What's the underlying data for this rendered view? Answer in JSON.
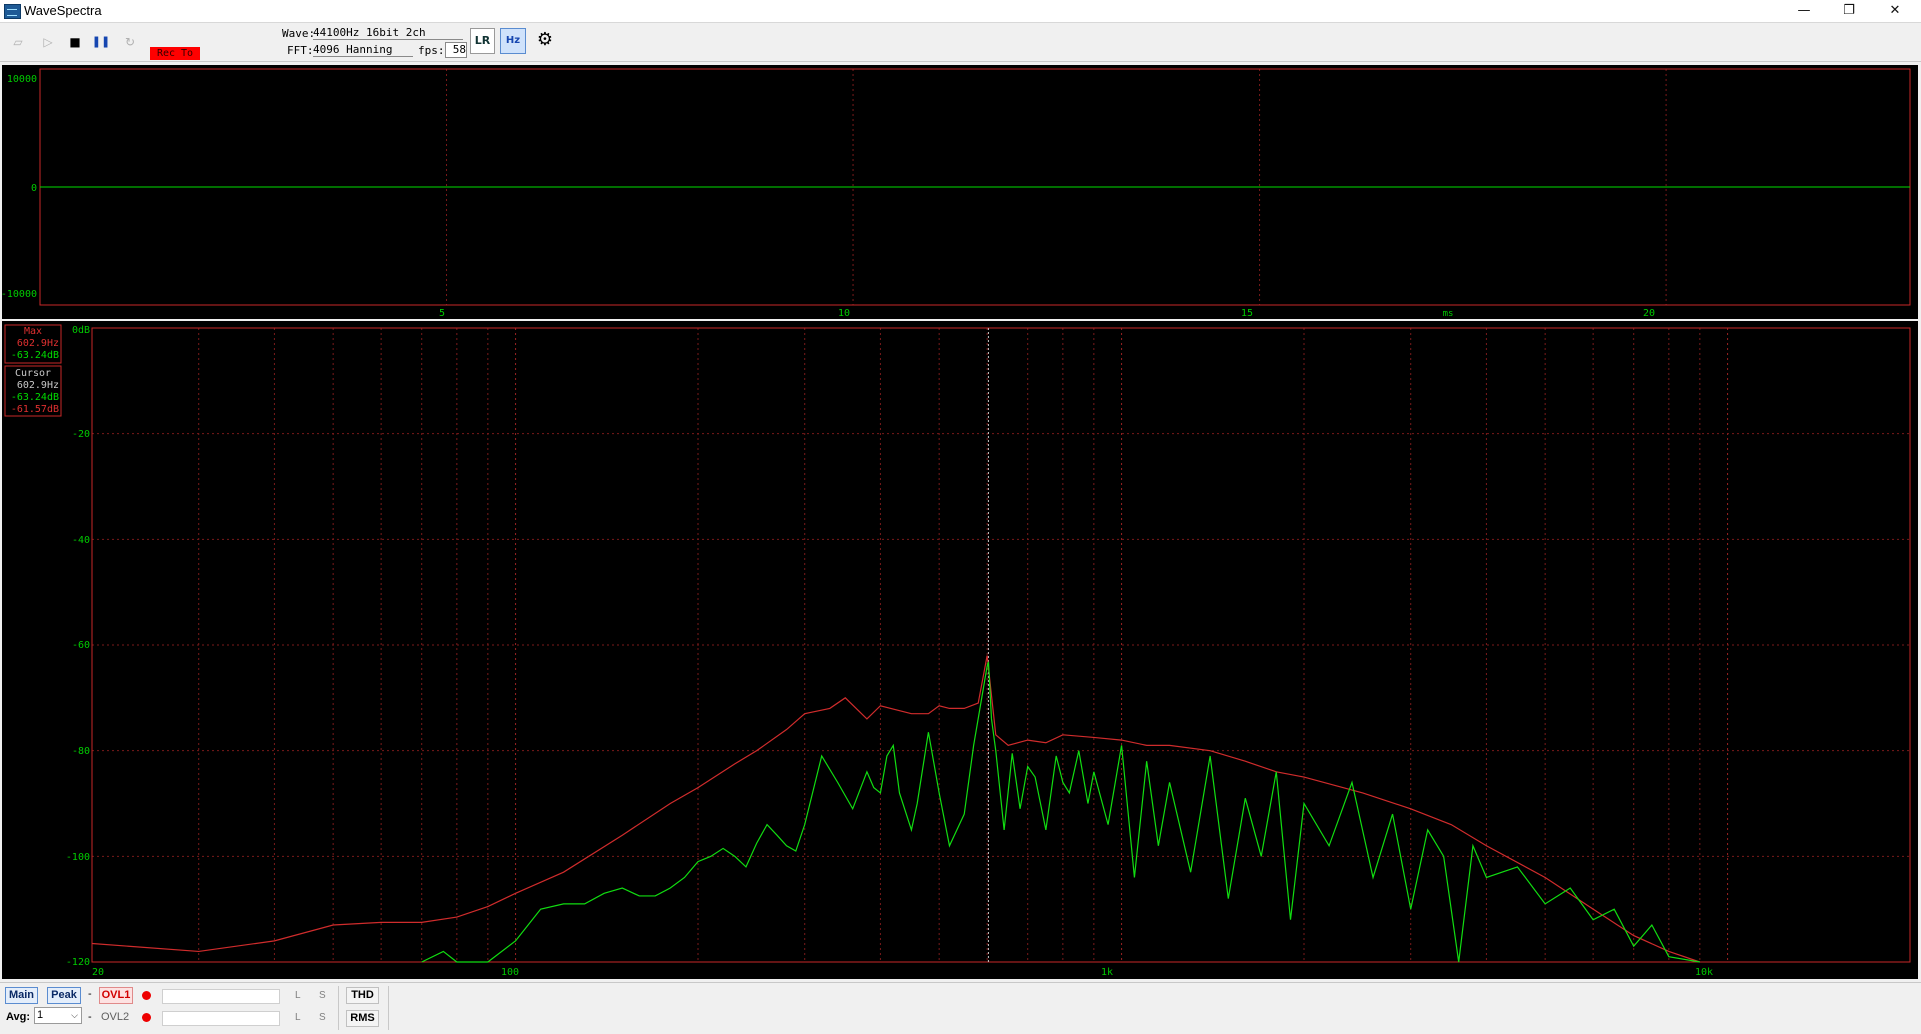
{
  "window": {
    "title": "WaveSpectra",
    "minimize_glyph": "—",
    "restore_glyph": "❐",
    "close_glyph": "✕"
  },
  "toolbar": {
    "rec_label": "Rec To",
    "wave_label": "Wave:",
    "wave_value": "44100Hz 16bit 2ch",
    "fft_label": "FFT:",
    "fft_value": "4096 Hanning",
    "fps_label": "fps:",
    "fps_value": "58",
    "lr_button": "LR",
    "icons": {
      "record_icon": "▱",
      "play_icon": "▷",
      "stop_icon": "■",
      "pause_icon": "❚❚",
      "loop_icon": "↻",
      "hz_icon": "Hz",
      "settings_icon": "⚙"
    }
  },
  "wave_chart": {
    "ytick_labels": [
      "10000",
      "0",
      "-10000"
    ],
    "xtick_labels": [
      "5",
      "10",
      "15",
      "ms",
      "20"
    ]
  },
  "spectrum_chart": {
    "ytick_labels": [
      "0dB",
      "-20",
      "-40",
      "-60",
      "-80",
      "-100",
      "-120"
    ],
    "xtick_labels": [
      "20",
      "100",
      "1k",
      "10k"
    ],
    "max_box": {
      "label": "Max",
      "freq": "602.9Hz",
      "level": "-63.24dB"
    },
    "cursor_box": {
      "label": "Cursor",
      "freq": "602.9Hz",
      "level_green": "-63.24dB",
      "level_red": "-61.57dB"
    }
  },
  "chart_data": [
    {
      "type": "line",
      "x": [
        0,
        23
      ],
      "series": [
        {
          "values": [
            0,
            0
          ]
        }
      ],
      "xlim": [
        0,
        23
      ],
      "ylim": [
        -10000,
        10000
      ],
      "grid": true,
      "colors": {
        "background": "#000000",
        "frame": "#c82828",
        "grid": "#7a1a1a",
        "signal": "#00dd00",
        "label": "#00cc00"
      }
    },
    {
      "type": "line",
      "xscale": "log",
      "xlim": [
        20,
        20000
      ],
      "ylim": [
        -120,
        0
      ],
      "grid": true,
      "cursor_x": 602.9,
      "colors": {
        "background": "#000000",
        "frame": "#c82828",
        "grid": "#7a1a1a",
        "max_line": "#d02c2c",
        "live_line": "#11dd11",
        "label": "#00cc00"
      },
      "series": [
        {
          "x": [
            20,
            30,
            40,
            50,
            60,
            70,
            80,
            90,
            100,
            120,
            150,
            180,
            200,
            230,
            250,
            280,
            300,
            330,
            350,
            380,
            400,
            450,
            480,
            500,
            520,
            550,
            580,
            600,
            620,
            650,
            700,
            750,
            800,
            900,
            1000,
            1100,
            1200,
            1400,
            1600,
            1800,
            2000,
            2500,
            3000,
            3500,
            4000,
            5000,
            6000,
            7000,
            8000,
            9000
          ],
          "values": [
            -116.5,
            -118,
            -116,
            -113,
            -112.5,
            -112.5,
            -111.5,
            -109.5,
            -107,
            -103,
            -96,
            -90,
            -87,
            -82.5,
            -80,
            -76,
            -73,
            -72,
            -70,
            -74,
            -71.5,
            -73,
            -73,
            -71.5,
            -72,
            -72,
            -71,
            -62,
            -77,
            -79,
            -78,
            -78.5,
            -77,
            -77.5,
            -78,
            -79,
            -79,
            -80,
            -82,
            -84,
            -85,
            -88,
            -91,
            -94,
            -98,
            -104,
            -110,
            -115,
            -118,
            -120
          ]
        },
        {
          "x": [
            70,
            76,
            80,
            90,
            100,
            110,
            120,
            130,
            140,
            150,
            160,
            170,
            180,
            190,
            200,
            210,
            220,
            230,
            240,
            250,
            260,
            270,
            280,
            290,
            300,
            320,
            340,
            360,
            380,
            390,
            400,
            410,
            420,
            430,
            450,
            460,
            480,
            500,
            520,
            550,
            570,
            600,
            603,
            610,
            620,
            640,
            660,
            680,
            700,
            720,
            750,
            780,
            800,
            820,
            850,
            880,
            900,
            950,
            1000,
            1050,
            1100,
            1150,
            1200,
            1300,
            1400,
            1500,
            1600,
            1700,
            1800,
            1900,
            2000,
            2200,
            2400,
            2600,
            2800,
            3000,
            3200,
            3400,
            3600,
            3800,
            4000,
            4500,
            5000,
            5500,
            6000,
            6500,
            7000,
            7500,
            8000,
            9000
          ],
          "values": [
            -120,
            -118,
            -120,
            -120,
            -116,
            -110,
            -109,
            -109,
            -107,
            -106,
            -107.5,
            -107.5,
            -106,
            -104,
            -101,
            -100,
            -98.5,
            -100,
            -102,
            -97.5,
            -94,
            -96,
            -98,
            -99,
            -94,
            -81,
            -86,
            -91,
            -84,
            -87,
            -88,
            -81,
            -79,
            -88,
            -95,
            -90,
            -76.5,
            -88,
            -98,
            -92,
            -79,
            -64,
            -63.2,
            -74,
            -80,
            -95,
            -80.5,
            -91,
            -83,
            -85,
            -95,
            -81,
            -86,
            -88,
            -80,
            -90,
            -84,
            -94,
            -79,
            -104,
            -82,
            -98,
            -86,
            -103,
            -81,
            -108,
            -89,
            -100,
            -84,
            -112,
            -90,
            -98,
            -86,
            -104,
            -92,
            -110,
            -95,
            -100,
            -120,
            -98,
            -104,
            -102,
            -109,
            -106,
            -112,
            -110,
            -117,
            -113,
            -119,
            -120
          ]
        }
      ]
    }
  ],
  "bottom": {
    "main_button": "Main",
    "peak_button": "Peak",
    "dash1": "-",
    "ovl1_button": "OVL1",
    "ovl2_label": "OVL2",
    "dash2": "-",
    "avg_label": "Avg:",
    "avg_value": "1",
    "l_label": "L",
    "s_label": "S",
    "thd_button": "THD",
    "rms_button": "RMS"
  }
}
